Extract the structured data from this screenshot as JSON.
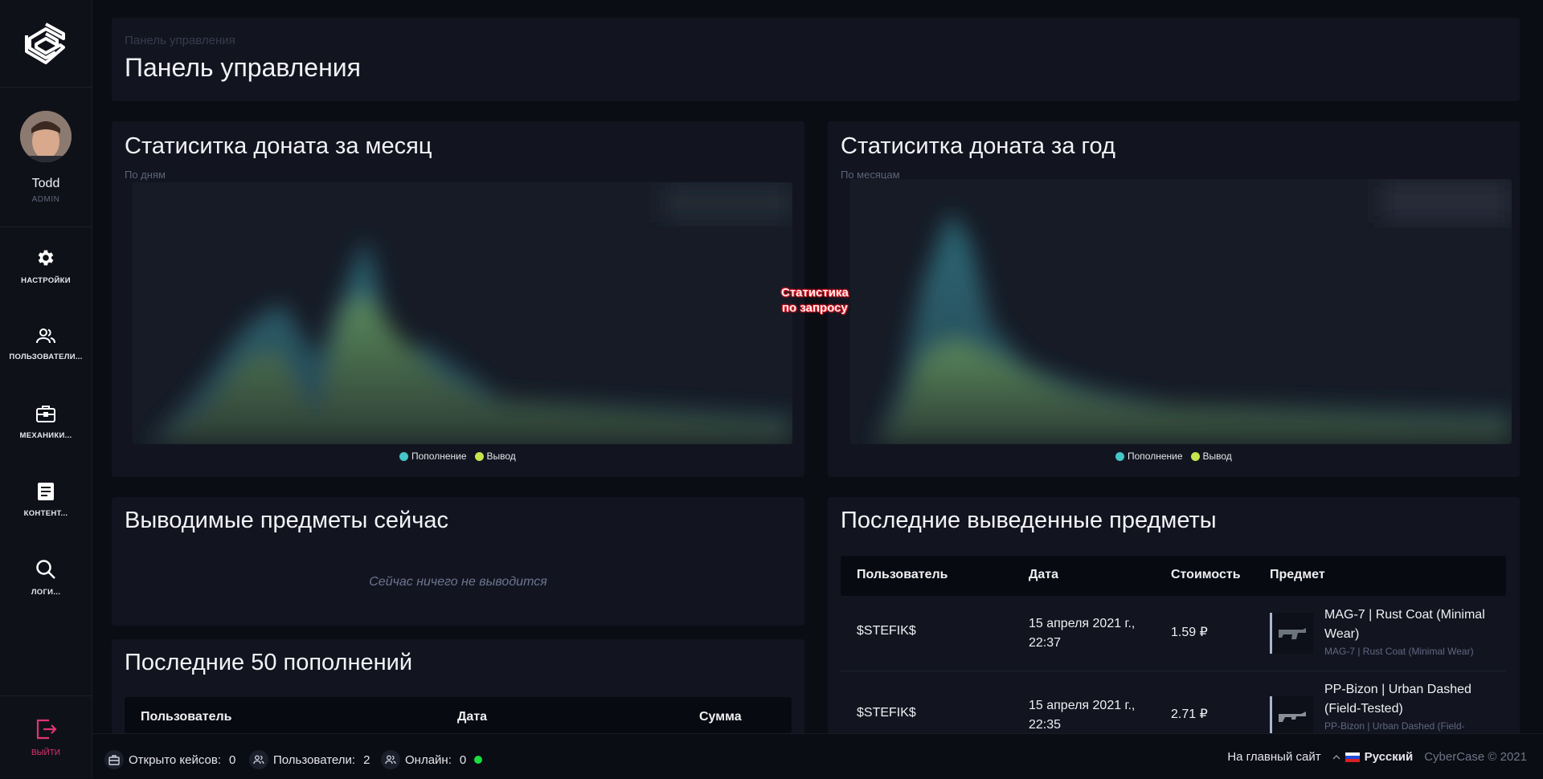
{
  "sidebar": {
    "user": {
      "name": "Todd",
      "role": "ADMIN"
    },
    "items": [
      {
        "label": "НАСТРОЙКИ",
        "icon": "gear-icon"
      },
      {
        "label": "ПОЛЬЗОВАТЕЛИ...",
        "icon": "users-icon"
      },
      {
        "label": "МЕХАНИКИ...",
        "icon": "briefcase-icon"
      },
      {
        "label": "КОНТЕНТ...",
        "icon": "document-icon"
      },
      {
        "label": "ЛОГИ...",
        "icon": "search-icon"
      }
    ],
    "logout_label": "ВЫЙТИ"
  },
  "header": {
    "breadcrumb": "Панель управления",
    "title": "Панель управления"
  },
  "month_chart": {
    "title": "Статиситка доната за месяц",
    "subtitle": "По дням"
  },
  "year_chart": {
    "title": "Статиситка доната за год",
    "subtitle": "По месяцам"
  },
  "legend": {
    "deposit": "Пополнение",
    "withdraw": "Вывод"
  },
  "stamp": {
    "line1": "Статистика",
    "line2": "по запросу"
  },
  "withdrawing_now": {
    "title": "Выводимые предметы сейчас",
    "empty": "Сейчас ничего не выводится"
  },
  "last_deposits": {
    "title": "Последние 50 пополнений",
    "headers": {
      "user": "Пользователь",
      "date": "Дата",
      "sum": "Сумма"
    }
  },
  "last_withdrawn": {
    "title": "Последние выведенные предметы",
    "headers": {
      "user": "Пользователь",
      "date": "Дата",
      "cost": "Стоимость",
      "item": "Предмет"
    },
    "rows": [
      {
        "user": "$STEFIK$",
        "date": "15 апреля 2021 г., 22:37",
        "cost": "1.59 ₽",
        "item": "MAG-7 | Rust Coat (Minimal Wear)",
        "item_sub": "MAG-7 | Rust Coat (Minimal Wear)"
      },
      {
        "user": "$STEFIK$",
        "date": "15 апреля 2021 г., 22:35",
        "cost": "2.71 ₽",
        "item": "PP-Bizon | Urban Dashed (Field-Tested)",
        "item_sub": "PP-Bizon | Urban Dashed (Field-"
      }
    ]
  },
  "footer": {
    "cases_label": "Открыто кейсов:",
    "cases_value": "0",
    "users_label": "Пользователи:",
    "users_value": "2",
    "online_label": "Онлайн:",
    "online_value": "0",
    "main_site": "На главный сайт",
    "language": "Русский",
    "copyright": "CyberCase © 2021"
  },
  "colors": {
    "deposit": "#45c6c8",
    "withdraw": "#c6e54d",
    "logout": "#e0356f",
    "online": "#1adf3c"
  }
}
